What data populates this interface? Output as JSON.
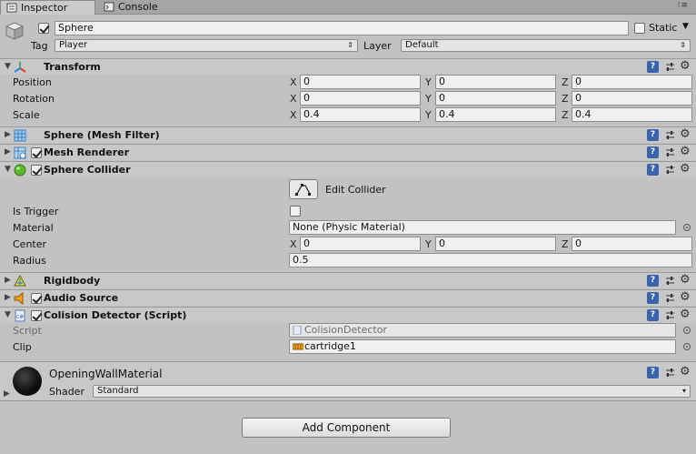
{
  "tabs": [
    {
      "label": "Inspector",
      "icon": "inspector-icon"
    },
    {
      "label": "Console",
      "icon": "console-icon"
    }
  ],
  "gameobject": {
    "active": true,
    "name": "Sphere",
    "static_label": "Static",
    "static": false,
    "tag_label": "Tag",
    "tag": "Player",
    "layer_label": "Layer",
    "layer": "Default"
  },
  "transform": {
    "title": "Transform",
    "position_label": "Position",
    "rotation_label": "Rotation",
    "scale_label": "Scale",
    "axis": {
      "x": "X",
      "y": "Y",
      "z": "Z"
    },
    "position": {
      "x": "0",
      "y": "0",
      "z": "0"
    },
    "rotation": {
      "x": "0",
      "y": "0",
      "z": "0"
    },
    "scale": {
      "x": "0.4",
      "y": "0.4",
      "z": "0.4"
    }
  },
  "mesh_filter": {
    "title": "Sphere (Mesh Filter)"
  },
  "mesh_renderer": {
    "title": "Mesh Renderer",
    "enabled": true
  },
  "sphere_collider": {
    "title": "Sphere Collider",
    "enabled": true,
    "edit_collider_label": "Edit Collider",
    "is_trigger_label": "Is Trigger",
    "is_trigger": false,
    "material_label": "Material",
    "material": "None (Physic Material)",
    "center_label": "Center",
    "center": {
      "x": "0",
      "y": "0",
      "z": "0"
    },
    "radius_label": "Radius",
    "radius": "0.5"
  },
  "rigidbody": {
    "title": "Rigidbody"
  },
  "audio_source": {
    "title": "Audio Source",
    "enabled": true
  },
  "colision_detector": {
    "title": "Colision Detector (Script)",
    "enabled": true,
    "script_label": "Script",
    "script": "ColisionDetector",
    "clip_label": "Clip",
    "clip": "cartridge1"
  },
  "material": {
    "name": "OpeningWallMaterial",
    "shader_label": "Shader",
    "shader": "Standard"
  },
  "add_component_label": "Add Component",
  "colors": {
    "background": "#c2c2c2",
    "help_icon": "#3b64a8",
    "collider_green": "#5cb82e",
    "audio_orange": "#f0a020"
  }
}
